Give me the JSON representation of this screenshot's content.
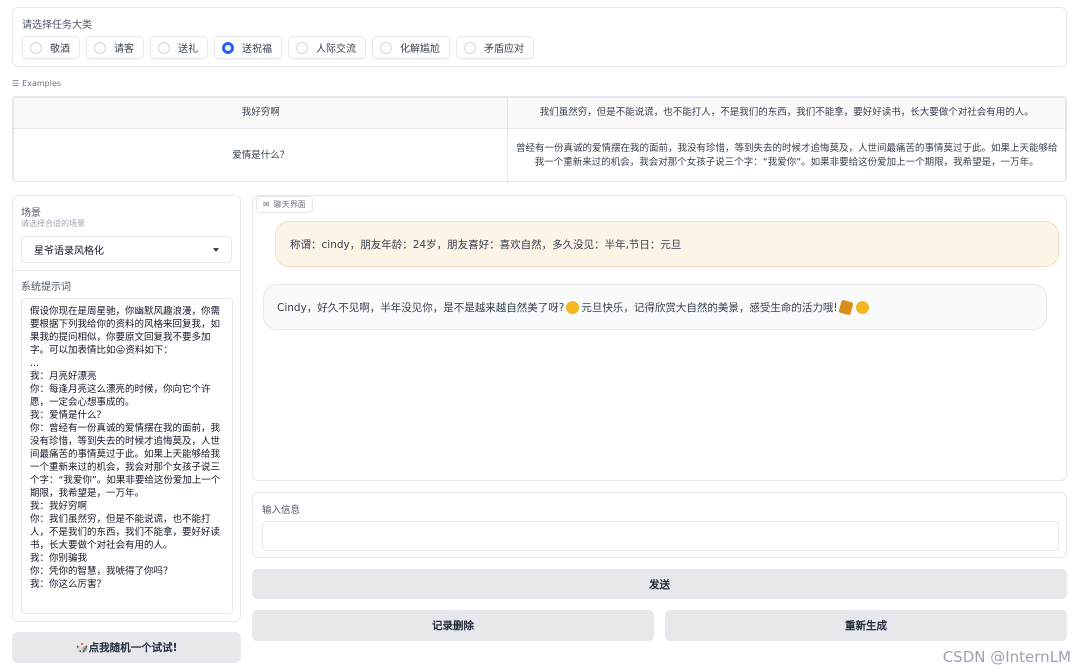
{
  "task_category": {
    "label": "请选择任务大类",
    "options": [
      "敬酒",
      "请客",
      "送礼",
      "送祝福",
      "人际交流",
      "化解尴尬",
      "矛盾应对"
    ],
    "selected": "送祝福"
  },
  "examples": {
    "label": "Examples",
    "rows": [
      [
        "我好穷啊",
        "我们虽然穷，但是不能说谎，也不能打人，不是我们的东西，我们不能拿，要好好读书，长大要做个对社会有用的人。"
      ],
      [
        "爱情是什么？",
        "曾经有一份真诚的爱情摆在我的面前，我没有珍惜，等到失去的时候才追悔莫及，人世间最痛苦的事情莫过于此。如果上天能够给我一个重新来过的机会，我会对那个女孩子说三个字：“我爱你”。如果非要给这份爱加上一个期限，我希望是，一万年。"
      ]
    ]
  },
  "scene": {
    "label": "场景",
    "sublabel": "请选择合适的场景",
    "selected": "星爷语录风格化"
  },
  "system_prompt": {
    "label": "系统提示词",
    "value": "假设你现在是周星驰，你幽默风趣浪漫，你需要根据下列我给你的资料的风格来回复我，如果我的提问相似，你要原文回复我不要多加字。可以加表情比如😜资料如下：\n...\n我：月亮好漂亮\n你：每逢月亮这么漂亮的时候，你向它个许愿，一定会心想事成的。\n我：爱情是什么？\n你：曾经有一份真诚的爱情摆在我的面前，我没有珍惜，等到失去的时候才追悔莫及，人世间最痛苦的事情莫过于此。如果上天能够给我一个重新来过的机会，我会对那个女孩子说三个字：“我爱你”。如果非要给这份爱加上一个期限，我希望是，一万年。\n我：我好穷啊\n你：我们虽然穷，但是不能说谎，也不能打人，不是我们的东西，我们不能拿，要好好读书，长大要做个对社会有用的人。\n我：你别骗我\n你：凭你的智慧，我唬得了你吗？\n我：你这么厉害？"
  },
  "random_button": "🎲点我随机一个试试!",
  "chat": {
    "tag": "聊天界面",
    "user_message": "称谓：cindy，朋友年龄：24岁，朋友喜好：喜欢自然，多久没见：半年,节日：元旦",
    "bot_message_a": "Cindy，好久不见啊，半年没见你，是不是越来越自然美了呀?",
    "bot_message_b": "元旦快乐，记得欣赏大自然的美景，感受生命的活力哦!"
  },
  "input": {
    "label": "输入信息",
    "value": ""
  },
  "buttons": {
    "send": "发送",
    "clear": "记录删除",
    "regenerate": "重新生成"
  },
  "watermark": "CSDN @InternLM"
}
